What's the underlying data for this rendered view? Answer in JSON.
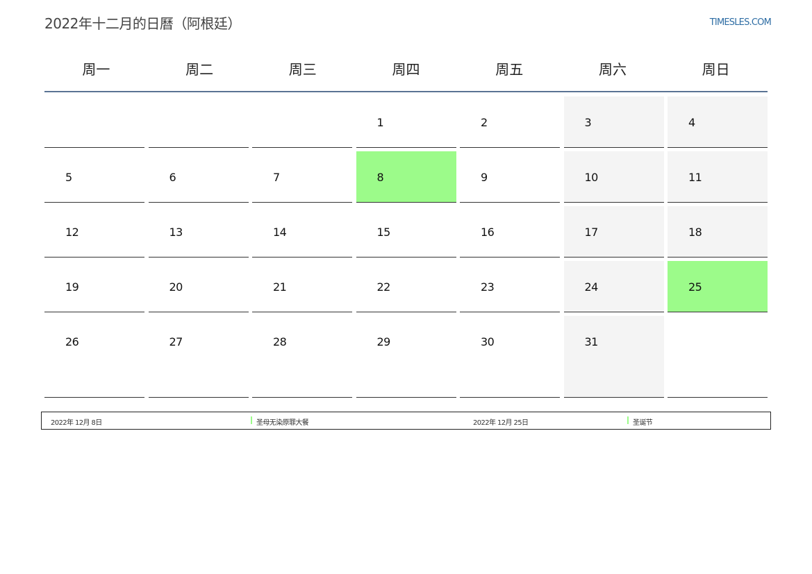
{
  "header": {
    "title": "2022年十二月的日曆（阿根廷）",
    "brand": "TIMESLES.COM"
  },
  "weekdays": [
    "周一",
    "周二",
    "周三",
    "周四",
    "周五",
    "周六",
    "周日"
  ],
  "weeks": [
    [
      "",
      "",
      "",
      "1",
      "2",
      "3",
      "4"
    ],
    [
      "5",
      "6",
      "7",
      "8",
      "9",
      "10",
      "11"
    ],
    [
      "12",
      "13",
      "14",
      "15",
      "16",
      "17",
      "18"
    ],
    [
      "19",
      "20",
      "21",
      "22",
      "23",
      "24",
      "25"
    ],
    [
      "26",
      "27",
      "28",
      "29",
      "30",
      "31",
      ""
    ]
  ],
  "holidays": [
    {
      "date": "2022年 12月 8日",
      "name": "圣母无染原罪大餐",
      "day": "8"
    },
    {
      "date": "2022年 12月 25日",
      "name": "圣诞节",
      "day": "25"
    }
  ],
  "colors": {
    "holiday": "#9cfb8a",
    "weekend": "#f4f4f4",
    "brand": "#2e6da4",
    "header_rule": "#5a7394"
  }
}
